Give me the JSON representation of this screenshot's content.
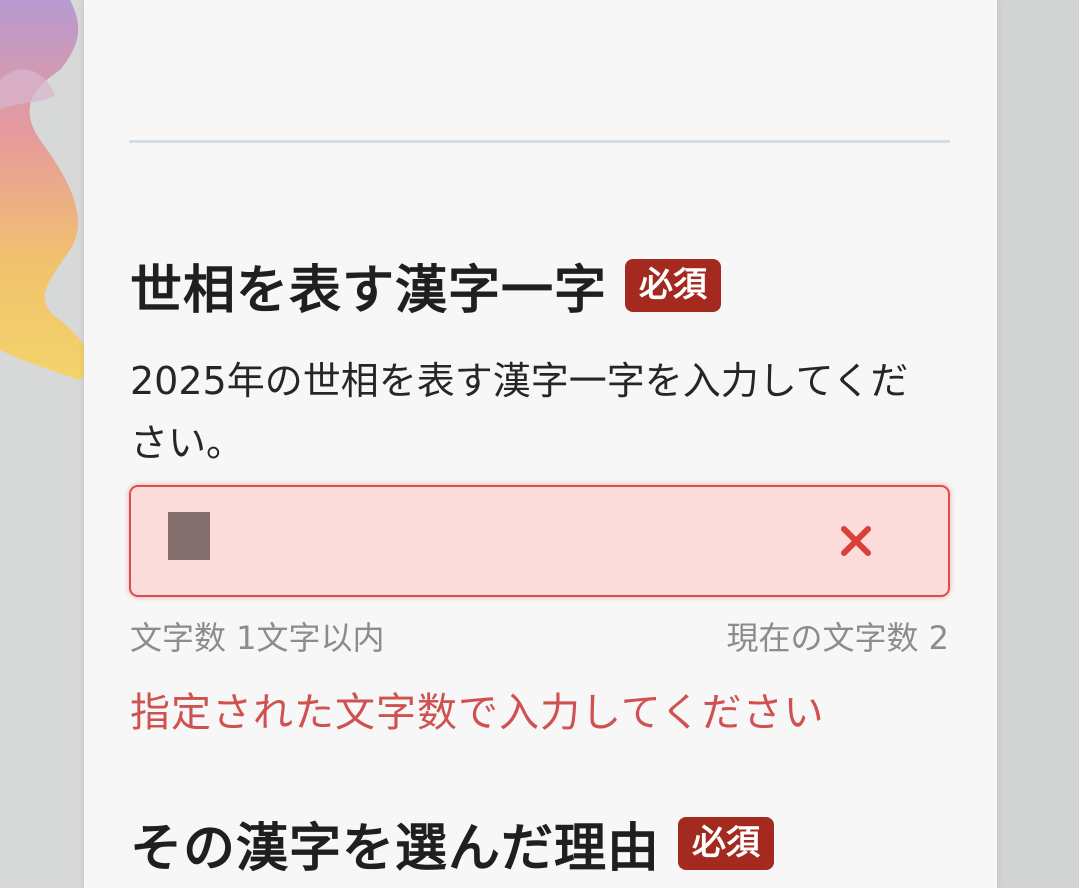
{
  "section1": {
    "title": "世相を表す漢字一字",
    "badge": "必須",
    "description": "2025年の世相を表す漢字一字を入力してください。",
    "input": {
      "value": "",
      "clear_icon": "close-icon"
    },
    "hint_max": "文字数 1文字以内",
    "hint_current": "現在の文字数 2",
    "error": "指定された文字数で入力してください"
  },
  "section2": {
    "title": "その漢字を選んだ理由",
    "badge": "必須"
  },
  "colors": {
    "required_badge": "#a4291f",
    "error": "#cf5250",
    "input_error_bg": "#fcdcdb"
  }
}
